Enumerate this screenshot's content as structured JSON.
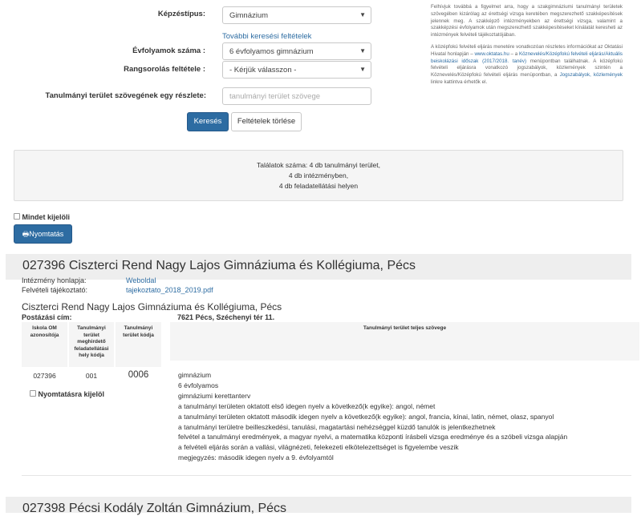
{
  "search": {
    "kepzestipus_label": "Képzéstípus:",
    "kepzestipus_value": "Gimnázium",
    "tovabbi_link": "További keresési feltételek",
    "evfolyamok_label": "Évfolyamok száma :",
    "evfolyamok_value": "6 évfolyamos gimnázium",
    "rangsor_label": "Rangsorolás feltétele :",
    "rangsor_value": "- Kérjük válasszon -",
    "szoveg_label": "Tanulmányi terület szövegének egy részlete:",
    "szoveg_placeholder": "tanulmányi terület szövege",
    "search_button": "Keresés",
    "clear_button": "Feltételek törlése"
  },
  "info": {
    "p1": "Felhívjuk továbbá a figyelmet arra, hogy a szakgimnáziumi tanulmányi területek szövegében kizárólag az érettségi vizsga keretében megszerezhető szakképesítések jelennek meg. A szakképző intézményekben az érettségi vizsga, valamint a szakképzési évfolyamok után megszerezhető szakképesítéseket kínálatát keresheti az intézmények felvételi tájékoztatójában.",
    "p2_a": "A középfokú felvételi eljárás menetére vonatkozóan részletes információkat az Oktatási Hivatal honlapján – ",
    "p2_link1": "www.oktatas.hu",
    "p2_b": " – a ",
    "p2_link2": "Köznevelés/Középfokú felvételi eljárás/Aktuális beiskolázási időszak (2017/2018. tanév)",
    "p2_c": " menüpontban találhatnak. A középfokú felvételi eljárásra vonatkozó jogszabályok, közlemények szintén a Köznevelés/Középfokú felvételi eljárás menüpontban, a ",
    "p2_link3": "Jogszabályok, közlemények",
    "p2_d": " linkre kattintva érhetők el."
  },
  "results": {
    "line1": "Találatok száma: 4 db tanulmányi terület,",
    "line2": "4 db intézményben,",
    "line3": "4 db feladatellátási helyen"
  },
  "select_all_label": "Mindet kijelöli",
  "print_button": "Nyomtatás",
  "school": {
    "title": "027396 Ciszterci Rend Nagy Lajos Gimnáziuma és Kollégiuma, Pécs",
    "homepage_label": "Intézmény honlapja:",
    "homepage_link": "Weboldal",
    "brochure_label": "Felvételi tájékoztató:",
    "brochure_link": "tajekoztato_2018_2019.pdf",
    "name": "Ciszterci Rend Nagy Lajos Gimnáziuma és Kollégiuma, Pécs",
    "postal_label": "Postázási cím:",
    "postal_value": "7621 Pécs, Széchenyi tér 11.",
    "table_headers": [
      "Iskola OM azonosítója",
      "Tanulmányi terület meghirdető feladatellátási hely kódja",
      "Tanulmányi terület kódja",
      "Tanulmányi terület teljes szövege"
    ],
    "row": {
      "om": "027396",
      "site_code": "001",
      "area_code": "0006",
      "print_select_label": "Nyomtatásra kijelöl",
      "details": [
        "gimnázium",
        "6 évfolyamos",
        "gimnáziumi kerettanterv",
        "a tanulmányi területen oktatott első idegen nyelv a következő(k egyike): angol, német",
        "a tanulmányi területen oktatott második idegen nyelv a következő(k egyike): angol, francia, kínai, latin, német, olasz, spanyol",
        "a tanulmányi területre beilleszkedési, tanulási, magatartási nehézséggel küzdő tanulók is jelentkezhetnek",
        "felvétel a tanulmányi eredmények, a magyar nyelvi, a matematika központi írásbeli vizsga eredménye és a szóbeli vizsga alapján",
        "a felvételi eljárás során a vallási, világnézeti, felekezeti elkötelezettséget is figyelembe veszik",
        "megjegyzés: második idegen nyelv a 9. évfolyamtól"
      ]
    }
  },
  "next_school_title": "027398 Pécsi Kodály Zoltán Gimnázium, Pécs"
}
